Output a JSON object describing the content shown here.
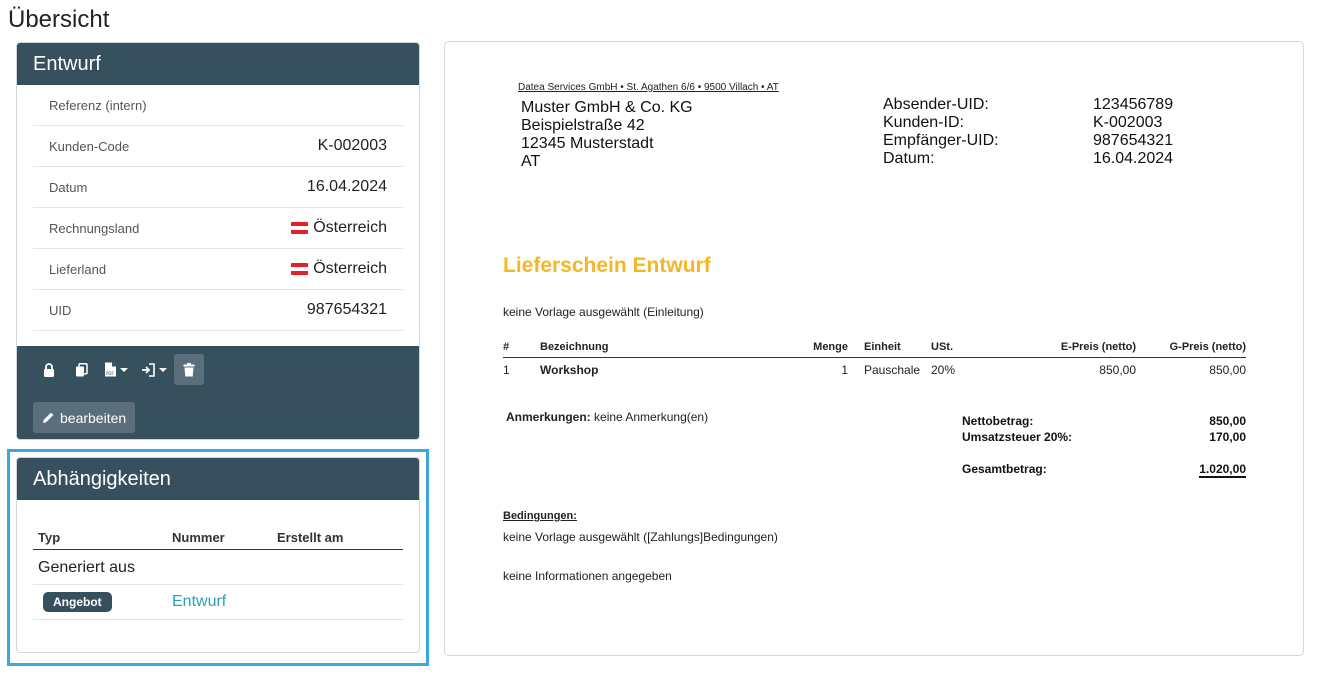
{
  "page": {
    "title": "Übersicht"
  },
  "draft_card": {
    "title": "Entwurf",
    "rows": [
      {
        "label": "Referenz (intern)",
        "value": ""
      },
      {
        "label": "Kunden-Code",
        "value": "K-002003"
      },
      {
        "label": "Datum",
        "value": "16.04.2024"
      },
      {
        "label": "Rechnungsland",
        "value": "Österreich",
        "flag": "austria-flag"
      },
      {
        "label": "Lieferland",
        "value": "Österreich",
        "flag": "austria-flag"
      },
      {
        "label": "UID",
        "value": "987654321"
      }
    ],
    "toolbar": {
      "icons": [
        "lock-icon",
        "copy-icon",
        "pdf-icon",
        "sign-in-icon",
        "trash-icon"
      ],
      "edit_label": "bearbeiten"
    }
  },
  "dependencies_card": {
    "title": "Abhängigkeiten",
    "columns": [
      "Typ",
      "Nummer",
      "Erstellt am"
    ],
    "group_label": "Generiert aus",
    "rows": [
      {
        "type_badge": "Angebot",
        "number": "Entwurf",
        "created": ""
      }
    ]
  },
  "document": {
    "sender_line": "Datea Services GmbH • St. Agathen 6/6 • 9500 Villach • AT",
    "recipient": [
      "Muster GmbH & Co. KG",
      "Beispielstraße 42",
      "12345 Musterstadt",
      "AT"
    ],
    "meta": [
      {
        "key": "Absender-UID:",
        "value": "123456789"
      },
      {
        "key": "Kunden-ID:",
        "value": "K-002003"
      },
      {
        "key": "Empfänger-UID:",
        "value": "987654321"
      },
      {
        "key": "Datum:",
        "value": "16.04.2024"
      }
    ],
    "title": "Lieferschein Entwurf",
    "intro": "keine Vorlage ausgewählt (Einleitung)",
    "table": {
      "headers": [
        "#",
        "Bezeichnung",
        "Menge",
        "Einheit",
        "USt.",
        "E-Preis (netto)",
        "G-Preis (netto)"
      ],
      "rows": [
        [
          "1",
          "Workshop",
          "1",
          "Pauschale",
          "20%",
          "850,00",
          "850,00"
        ]
      ]
    },
    "remarks_label": "Anmerkungen:",
    "remarks_text": " keine Anmerkung(en)",
    "totals": {
      "net_label": "Nettobetrag:",
      "net_value": "850,00",
      "tax_label": "Umsatzsteuer 20%:",
      "tax_value": "170,00",
      "grand_label": "Gesamtbetrag:",
      "grand_value": "1.020,00"
    },
    "conditions_title": "Bedingungen:",
    "conditions_text": "keine Vorlage ausgewählt ([Zahlungs]Bedingungen)",
    "info_text": "keine Informationen angegeben"
  },
  "colors": {
    "panel": "#37505e",
    "accent_title": "#f5b625",
    "link": "#2a9fbc",
    "highlight": "#3aa8e0"
  }
}
